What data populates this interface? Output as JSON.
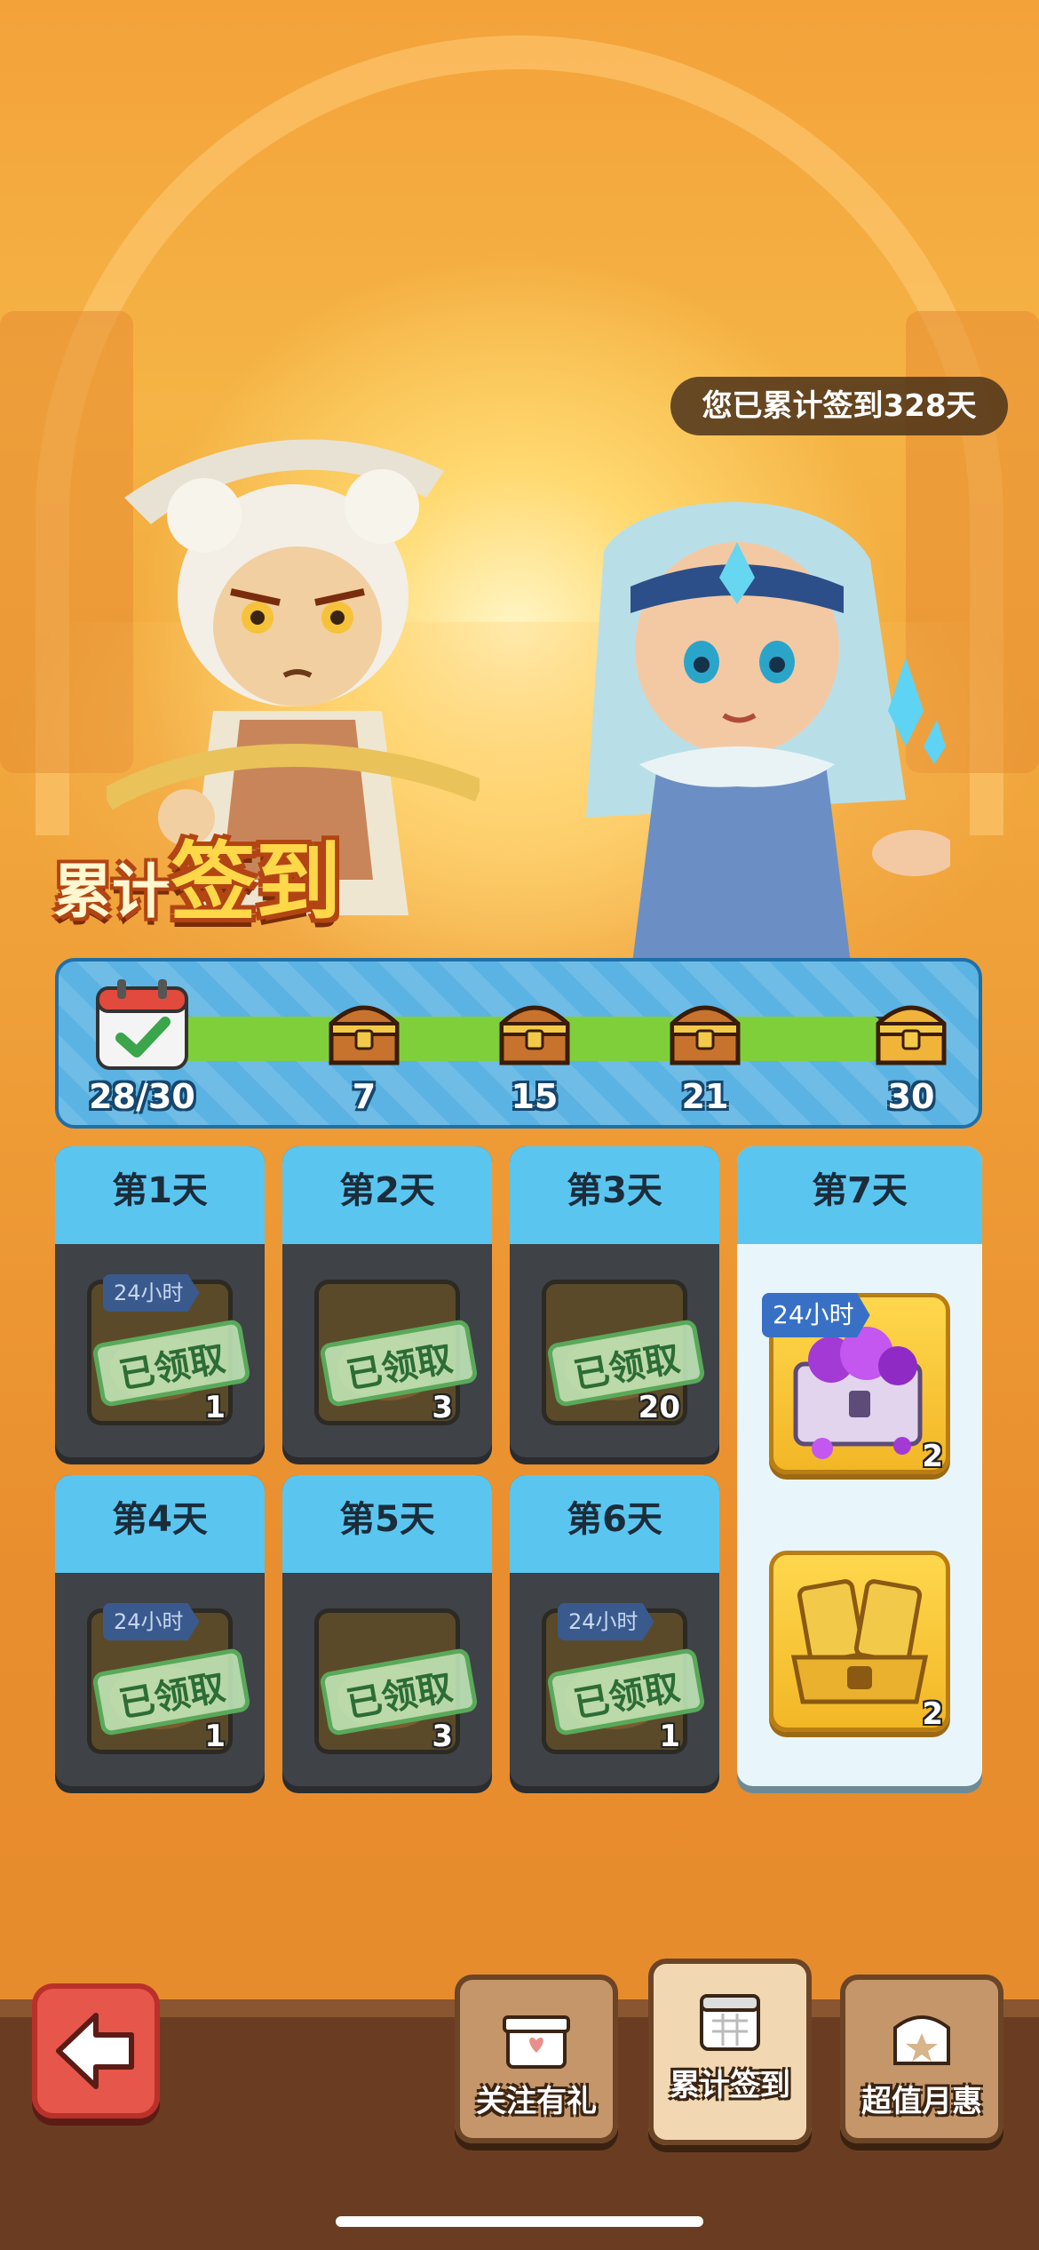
{
  "header": {
    "total_checkins": "您已累计签到328天"
  },
  "title": {
    "part1": "累计",
    "part2": "签到"
  },
  "progress": {
    "current_label": "28/30",
    "current": 28,
    "total": 30,
    "milestones": [
      "7",
      "15",
      "21",
      "30"
    ]
  },
  "days": [
    {
      "label": "第1天",
      "count": "1",
      "claimed": "已领取",
      "timer": "24小时"
    },
    {
      "label": "第2天",
      "count": "3",
      "claimed": "已领取"
    },
    {
      "label": "第3天",
      "count": "20",
      "claimed": "已领取"
    },
    {
      "label": "第4天",
      "count": "1",
      "claimed": "已领取",
      "timer": "24小时"
    },
    {
      "label": "第5天",
      "count": "3",
      "claimed": "已领取"
    },
    {
      "label": "第6天",
      "count": "1",
      "claimed": "已领取",
      "timer": "24小时"
    }
  ],
  "day7": {
    "label": "第7天",
    "items": [
      {
        "timer": "24小时",
        "count": "2",
        "icon": "purple-gem-chest-icon"
      },
      {
        "count": "2",
        "icon": "golden-hero-cards-chest-icon"
      }
    ]
  },
  "bottom_tabs": [
    {
      "label": "关注有礼",
      "icon": "gift-icon"
    },
    {
      "label": "累计签到",
      "icon": "calendar-icon"
    },
    {
      "label": "超值月惠",
      "icon": "star-chest-icon"
    }
  ],
  "colors": {
    "panel_blue": "#5bb3e3",
    "progress_green": "#7fcf3b",
    "back_button": "#e6564a",
    "day_header": "#5ac6f0"
  }
}
